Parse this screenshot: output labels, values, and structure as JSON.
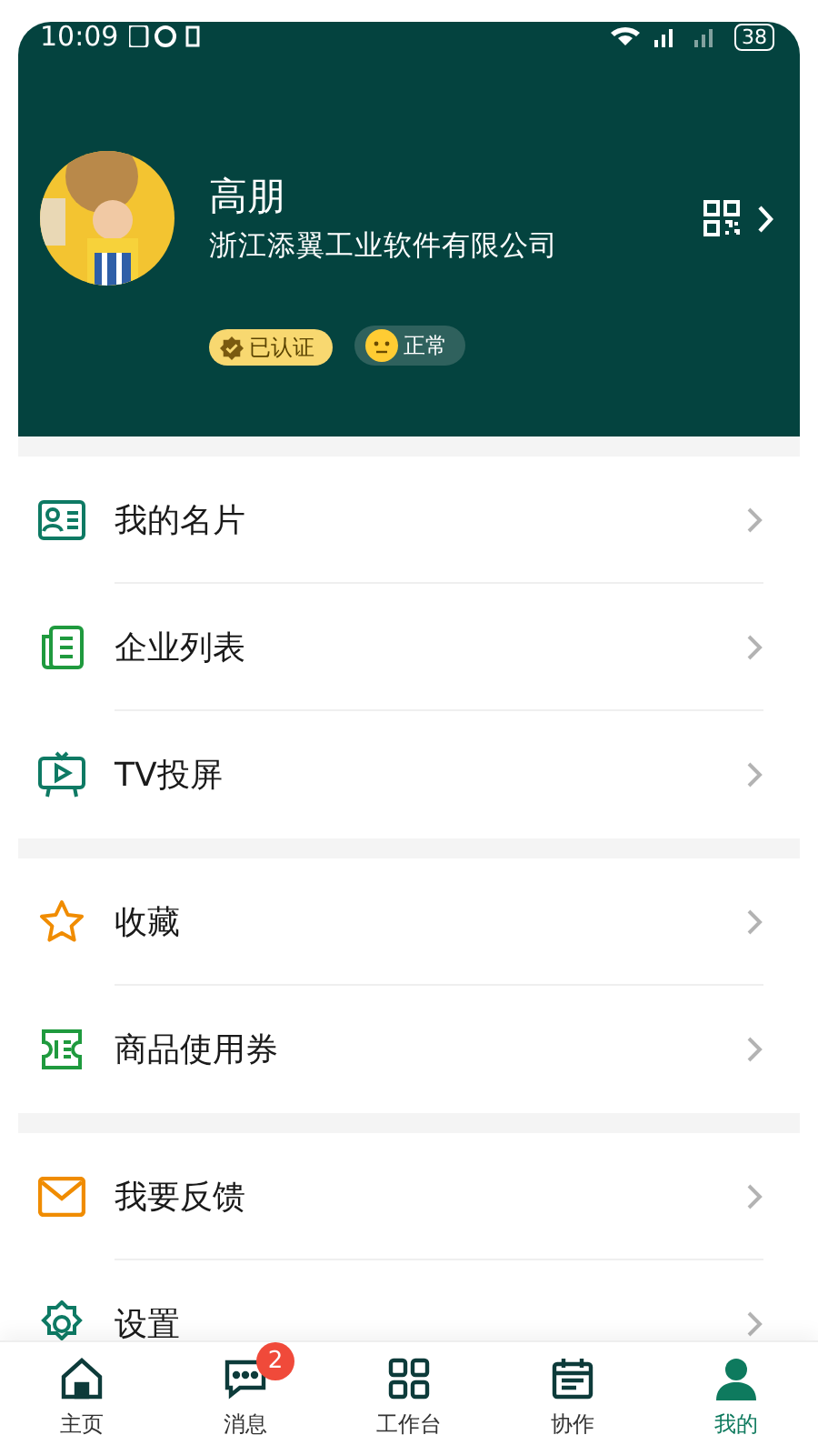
{
  "status_bar": {
    "time": "10:09",
    "battery": "38"
  },
  "profile": {
    "name": "高朋",
    "company": "浙江添翼工业软件有限公司",
    "badges": [
      {
        "kind": "verified",
        "label": "已认证"
      },
      {
        "kind": "mood",
        "label": "正常"
      }
    ]
  },
  "sections": [
    {
      "items": [
        {
          "kind": "card",
          "label": "我的名片"
        },
        {
          "kind": "list",
          "label": "企业列表"
        },
        {
          "kind": "tv",
          "label": "TV投屏"
        }
      ]
    },
    {
      "items": [
        {
          "kind": "star",
          "label": "收藏"
        },
        {
          "kind": "ticket",
          "label": "商品使用券"
        }
      ]
    },
    {
      "items": [
        {
          "kind": "mail",
          "label": "我要反馈"
        },
        {
          "kind": "gear",
          "label": "设置"
        }
      ]
    }
  ],
  "tab_bar": [
    {
      "kind": "home",
      "label": "主页",
      "selected": false
    },
    {
      "kind": "chat",
      "label": "消息",
      "selected": false,
      "badge": "2"
    },
    {
      "kind": "grid",
      "label": "工作台",
      "selected": false
    },
    {
      "kind": "calendar",
      "label": "协作",
      "selected": false
    },
    {
      "kind": "person",
      "label": "我的",
      "selected": true
    }
  ]
}
